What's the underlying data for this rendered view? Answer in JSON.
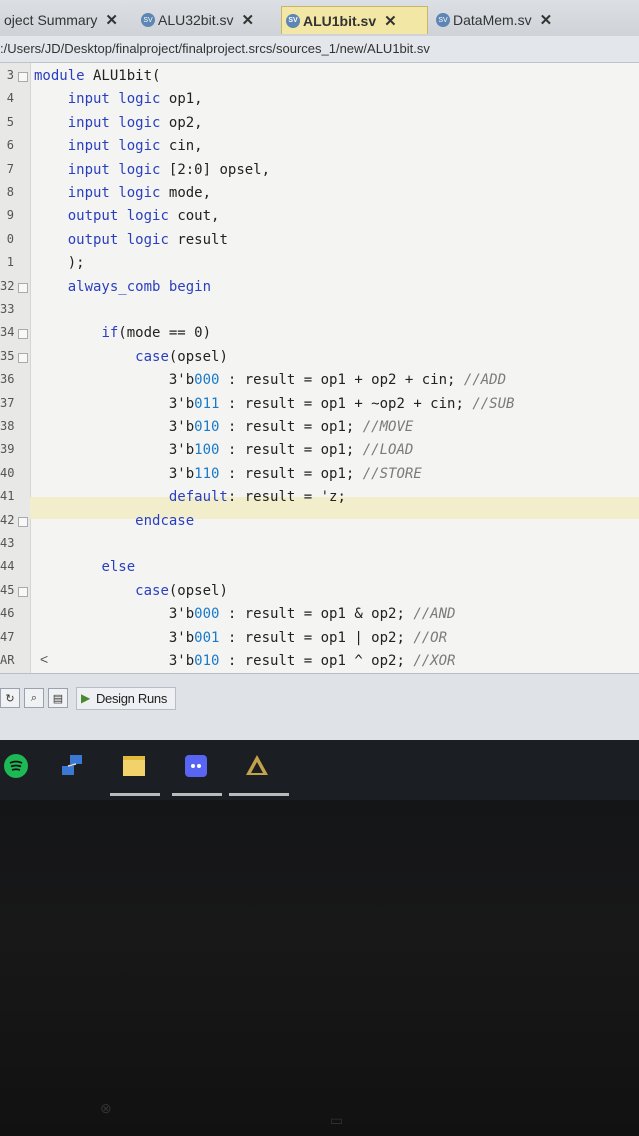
{
  "tabs": [
    {
      "label": "oject Summary",
      "active": false
    },
    {
      "label": "ALU32bit.sv",
      "active": false
    },
    {
      "label": "ALU1bit.sv",
      "active": true
    },
    {
      "label": "DataMem.sv",
      "active": false
    }
  ],
  "path": ":/Users/JD/Desktop/finalproject/finalproject.srcs/sources_1/new/ALU1bit.sv",
  "code_lines": [
    {
      "num": "3",
      "text": "module ALU1bit("
    },
    {
      "num": "4",
      "text": "    input logic op1,"
    },
    {
      "num": "5",
      "text": "    input logic op2,"
    },
    {
      "num": "6",
      "text": "    input logic cin,"
    },
    {
      "num": "7",
      "text": "    input logic [2:0] opsel,"
    },
    {
      "num": "8",
      "text": "    input logic mode,"
    },
    {
      "num": "9",
      "text": "    output logic cout,"
    },
    {
      "num": "0",
      "text": "    output logic result"
    },
    {
      "num": "1",
      "text": "    );"
    },
    {
      "num": "32",
      "text": "    always_comb begin"
    },
    {
      "num": "33",
      "text": ""
    },
    {
      "num": "34",
      "text": "        if(mode == 0)"
    },
    {
      "num": "35",
      "text": "            case(opsel)"
    },
    {
      "num": "36",
      "text": "                3'b000 : result = op1 + op2 + cin; //ADD"
    },
    {
      "num": "37",
      "text": "                3'b011 : result = op1 + ~op2 + cin; //SUB"
    },
    {
      "num": "38",
      "text": "                3'b010 : result = op1; //MOVE"
    },
    {
      "num": "39",
      "text": "                3'b100 : result = op1; //LOAD"
    },
    {
      "num": "40",
      "text": "                3'b110 : result = op1; //STORE"
    },
    {
      "num": "41",
      "text": "                default: result = 'z;"
    },
    {
      "num": "42",
      "text": "            endcase"
    },
    {
      "num": "43",
      "text": ""
    },
    {
      "num": "44",
      "text": "        else"
    },
    {
      "num": "45",
      "text": "            case(opsel)"
    },
    {
      "num": "46",
      "text": "                3'b000 : result = op1 & op2; //AND"
    },
    {
      "num": "47",
      "text": "                3'b001 : result = op1 | op2; //OR"
    },
    {
      "num": "AR",
      "text": "                3'b010 : result = op1 ^ op2; //XOR"
    }
  ],
  "scroll_left_label": "<",
  "panel": {
    "design_runs_label": "Design Runs"
  },
  "taskbar_icons": [
    "spotify-icon",
    "network-icon",
    "sticky-notes-icon",
    "discord-icon",
    "vivado-icon"
  ],
  "colors": {
    "keyword": "#2a3fc0",
    "number": "#1a7ac9",
    "comment": "#7a7a7a",
    "highlight_line": "#f2eecb",
    "active_tab": "#f3e7a6"
  }
}
